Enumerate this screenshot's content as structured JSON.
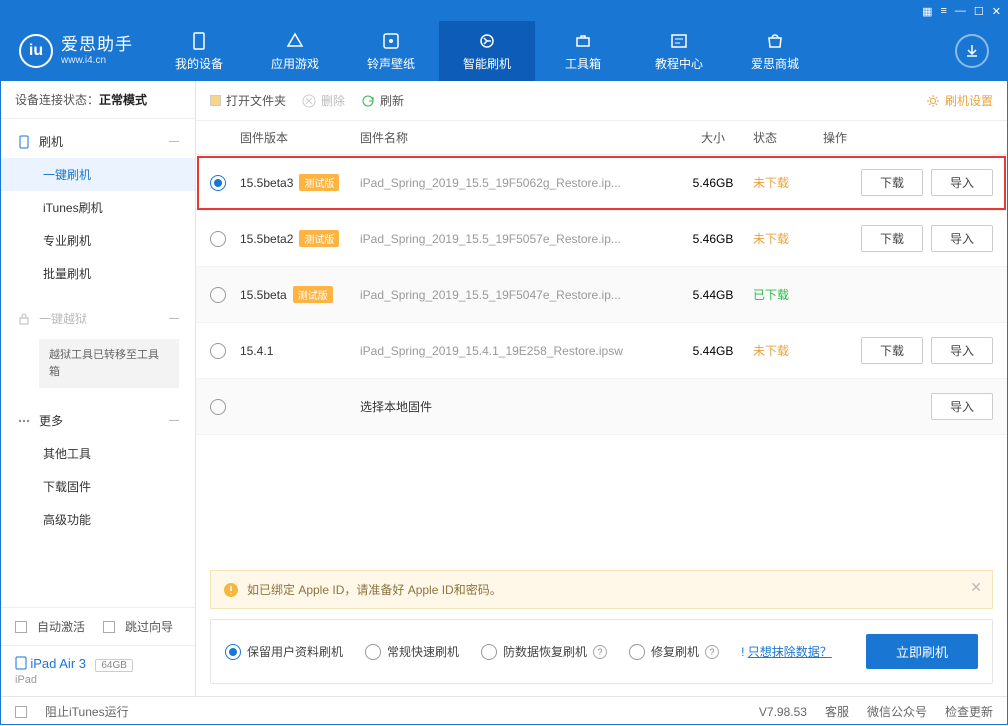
{
  "titlebar_icons": [
    "▦",
    "≡",
    "—",
    "☐",
    "✕"
  ],
  "logo": {
    "title": "爱思助手",
    "url": "www.i4.cn"
  },
  "nav": [
    {
      "label": "我的设备",
      "icon": "device"
    },
    {
      "label": "应用游戏",
      "icon": "apps"
    },
    {
      "label": "铃声壁纸",
      "icon": "media"
    },
    {
      "label": "智能刷机",
      "icon": "flash",
      "active": true
    },
    {
      "label": "工具箱",
      "icon": "tools"
    },
    {
      "label": "教程中心",
      "icon": "help"
    },
    {
      "label": "爱思商城",
      "icon": "store"
    }
  ],
  "sidebar": {
    "conn_label": "设备连接状态：",
    "conn_value": "正常模式",
    "sec_flash": {
      "title": "刷机",
      "items": [
        "一键刷机",
        "iTunes刷机",
        "专业刷机",
        "批量刷机"
      ],
      "active": 0
    },
    "sec_jb": {
      "title": "一键越狱",
      "note": "越狱工具已转移至工具箱"
    },
    "sec_more": {
      "title": "更多",
      "items": [
        "其他工具",
        "下载固件",
        "高级功能"
      ]
    },
    "foot": {
      "auto": "自动激活",
      "skip": "跳过向导"
    },
    "device": {
      "name": "iPad Air 3",
      "cap": "64GB",
      "type": "iPad"
    }
  },
  "toolbar": {
    "open": "打开文件夹",
    "delete": "删除",
    "refresh": "刷新",
    "settings": "刷机设置"
  },
  "columns": {
    "ver": "固件版本",
    "name": "固件名称",
    "size": "大小",
    "status": "状态",
    "actions": "操作"
  },
  "rows": [
    {
      "ver": "15.5beta3",
      "beta": true,
      "name": "iPad_Spring_2019_15.5_19F5062g_Restore.ip...",
      "size": "5.46GB",
      "status": "未下载",
      "st": "no",
      "sel": true,
      "hl": true,
      "btns": [
        "下载",
        "导入"
      ]
    },
    {
      "ver": "15.5beta2",
      "beta": true,
      "name": "iPad_Spring_2019_15.5_19F5057e_Restore.ip...",
      "size": "5.46GB",
      "status": "未下载",
      "st": "no",
      "btns": [
        "下载",
        "导入"
      ]
    },
    {
      "ver": "15.5beta",
      "beta": true,
      "name": "iPad_Spring_2019_15.5_19F5047e_Restore.ip...",
      "size": "5.44GB",
      "status": "已下载",
      "st": "yes",
      "alt": true,
      "btns": []
    },
    {
      "ver": "15.4.1",
      "beta": false,
      "name": "iPad_Spring_2019_15.4.1_19E258_Restore.ipsw",
      "size": "5.44GB",
      "status": "未下载",
      "st": "no",
      "btns": [
        "下载",
        "导入"
      ]
    },
    {
      "ver": "选择本地固件",
      "beta": false,
      "name": "",
      "size": "",
      "status": "",
      "st": "",
      "alt": true,
      "btns": [
        "导入"
      ],
      "local": true
    }
  ],
  "beta_tag": "测试版",
  "alert": "如已绑定 Apple ID，请准备好 Apple ID和密码。",
  "options": {
    "items": [
      "保留用户资料刷机",
      "常规快速刷机",
      "防数据恢复刷机",
      "修复刷机"
    ],
    "sel": 0,
    "link": "只想抹除数据？",
    "primary": "立即刷机"
  },
  "statusbar": {
    "block": "阻止iTunes运行",
    "ver": "V7.98.53",
    "svc": "客服",
    "wx": "微信公众号",
    "upd": "检查更新"
  }
}
